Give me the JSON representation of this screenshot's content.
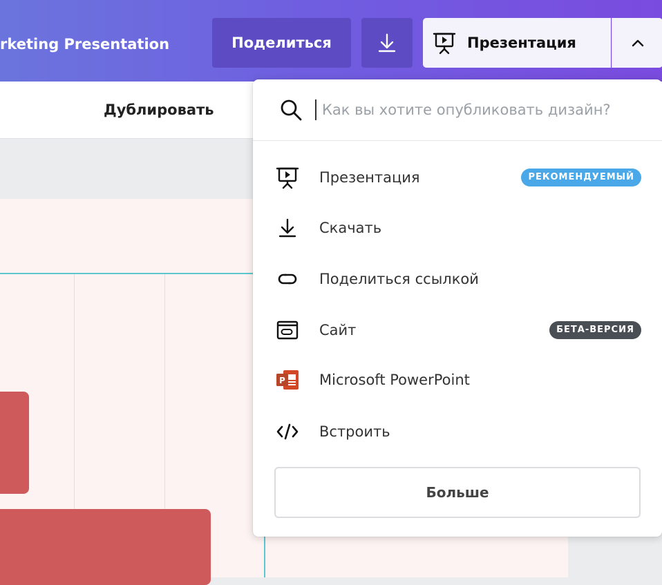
{
  "header": {
    "doc_title": "rketing Presentation",
    "share_label": "Поделиться",
    "download_icon": "download-icon",
    "present_label": "Презентация",
    "present_icon": "presentation-icon",
    "chevron_icon": "chevron-up-icon"
  },
  "toolbar": {
    "duplicate_label": "Дублировать"
  },
  "publish_menu": {
    "search": {
      "placeholder": "Как вы хотите опубликовать дизайн?",
      "value": ""
    },
    "items": [
      {
        "label": "Презентация",
        "icon": "presentation-icon",
        "badge": "РЕКОМЕНДУЕМЫЙ",
        "badge_color": "#4aa8e8"
      },
      {
        "label": "Скачать",
        "icon": "download-icon"
      },
      {
        "label": "Поделиться ссылкой",
        "icon": "link-icon"
      },
      {
        "label": "Сайт",
        "icon": "website-icon",
        "badge": "БЕТА-ВЕРСИЯ",
        "badge_color": "#4a4f55"
      },
      {
        "label": "Microsoft PowerPoint",
        "icon": "powerpoint-icon"
      },
      {
        "label": "Встроить",
        "icon": "embed-code-icon"
      }
    ],
    "more_label": "Больше"
  },
  "colors": {
    "topbar_gradient_start": "#6b74dd",
    "topbar_gradient_end": "#7a4bdf",
    "button_dark": "#5d4bc4",
    "canvas_bg": "#fdf3f2",
    "accent_teal": "#5bc7cf",
    "shape_red": "#cf5a5c",
    "powerpoint_orange": "#d24726"
  }
}
